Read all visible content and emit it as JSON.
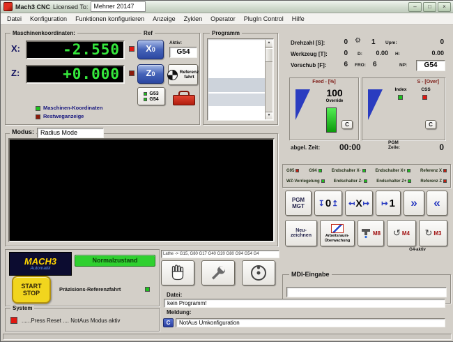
{
  "window": {
    "title": "Mach3 CNC",
    "licensed_label": "Licensed To:",
    "licensed_value": "Mehner 20147",
    "minimize_icon": "–",
    "maximize_icon": "□",
    "close_icon": "×"
  },
  "menu": {
    "items": [
      "Datei",
      "Konfiguration",
      "Funktionen konfigurieren",
      "Anzeige",
      "Zyklen",
      "Operator",
      "PlugIn Control",
      "Hilfe"
    ]
  },
  "coords": {
    "group_title": "Maschinenkoordinaten:",
    "ref_caption": "Ref",
    "x_label": "X:",
    "x_value": "-2.550",
    "z_label": "Z:",
    "z_value": "+0.000",
    "x_zero": "X",
    "x_zero_sub": "0",
    "z_zero": "Z",
    "z_zero_sub": "0",
    "aktiv_label": "Aktiv:",
    "aktiv_value": "G54",
    "ref_line1": "Referenz",
    "ref_line2": "fahrt",
    "g53_label": "G53",
    "g54_label": "G54",
    "machine_caption": "Maschinen-Koordinaten",
    "restweg_caption": "Restweganzeige"
  },
  "programm": {
    "group_title": "Programm",
    "scroll_up_icon": "▲",
    "scroll_down_icon": "▼"
  },
  "spindle": {
    "drehzahl_label": "Drehzahl [S]:",
    "drehzahl_value": "0",
    "pulley_icon": "⚙",
    "pulley_value": "1",
    "upm_label": "Upm:",
    "upm_value": "0",
    "werkzeug_label": "Werkzeug [T]:",
    "werkzeug_value": "0",
    "d_label": "D:",
    "d_value": "0.00",
    "h_label": "H:",
    "h_value": "0.00",
    "vorschub_label": "Vorschub [F]:",
    "vorschub_value": "6",
    "fro_label": "FRO:",
    "fro_value": "6",
    "np_label": "NP:",
    "np_value": "G54"
  },
  "feed": {
    "title": "Feed - [%]",
    "value": "100",
    "override_label": "Override",
    "clear_button": "C"
  },
  "sover": {
    "title": "S - [Over]",
    "index_label": "Index",
    "css_label": "CSS",
    "clear_button": "C"
  },
  "timers": {
    "zeit_label": "abgel. Zeit:",
    "zeit_value": "00:00",
    "pgm_line1": "PGM",
    "pgm_line2": "Zeile:",
    "pgm_value": "0"
  },
  "limits": {
    "row1": [
      {
        "label": "G95",
        "led": "#c22010"
      },
      {
        "label": "G94",
        "led": "#1dc21d"
      },
      {
        "label": "Endschalter X-",
        "led": "#1dc21d"
      },
      {
        "label": "Endschalter X+",
        "led": "#1dc21d"
      },
      {
        "label": "Referenz X",
        "led": "#c22010"
      }
    ],
    "row2": [
      {
        "label": "WZ-Verriegelung",
        "led": "#1dc21d"
      },
      {
        "label": "Endschalter Z-",
        "led": "#1dc21d"
      },
      {
        "label": "Endschalter Z+",
        "led": "#1dc21d"
      },
      {
        "label": "Referenz Z",
        "led": "#c22010"
      }
    ]
  },
  "actions": {
    "pgm_line1": "PGM",
    "pgm_line2": "MGT",
    "goto_zero_left": "↧",
    "goto_zero_num": "0",
    "goto_zero_right": "↥",
    "zero_x_left": "↤",
    "zero_x_letter": "X",
    "zero_x_right": "↦",
    "goto_one_icon": "↦",
    "goto_one_num": "1",
    "fwd_icon": "»",
    "back_icon": "«",
    "neu_line1": "Neu-",
    "neu_line2": "zeichnen",
    "arbeitsraum_line1": "Arbeitsraum-",
    "arbeitsraum_line2": "Überwachung",
    "m8_label": "M8",
    "m4_icon": "↺",
    "m4_label": "M4",
    "m3_icon": "↻",
    "m3_label": "M3",
    "g4_caption": "G4-aktiv"
  },
  "mdi": {
    "group_title": "MDI-Eingabe",
    "value": ""
  },
  "modus": {
    "label": "Modus:",
    "value": "Radius Mode"
  },
  "strip": {
    "gcode_line": "Lathe -> G15, G80 G17 G40 G20 G80 G94 G54 G4",
    "datei_label": "Datei:",
    "datei_value": "kein Programm!",
    "meldung_label": "Meldung:",
    "clear_button": "C",
    "meldung_value": "NotAus Umkonfiguration"
  },
  "control": {
    "logo_line1": "MACH3",
    "logo_line2": "Automatik",
    "normal_label": "Normalzustand",
    "start_line1": "START",
    "start_line2": "STOP",
    "praezision_caption": "Präzisions-Referenzfahrt"
  },
  "system": {
    "group_title": "System",
    "message": "......Press Reset .... NotAus Modus aktiv"
  },
  "colors": {
    "dro": "#35e83c",
    "led_red": "#e01810",
    "led_green": "#1dc21d",
    "led_dark": "#8c1a0a",
    "blue": "#2a3cc0",
    "normal_green": "#2fd02f",
    "start_yellow": "#f1d51e",
    "logo_yellow": "#ffd400"
  }
}
